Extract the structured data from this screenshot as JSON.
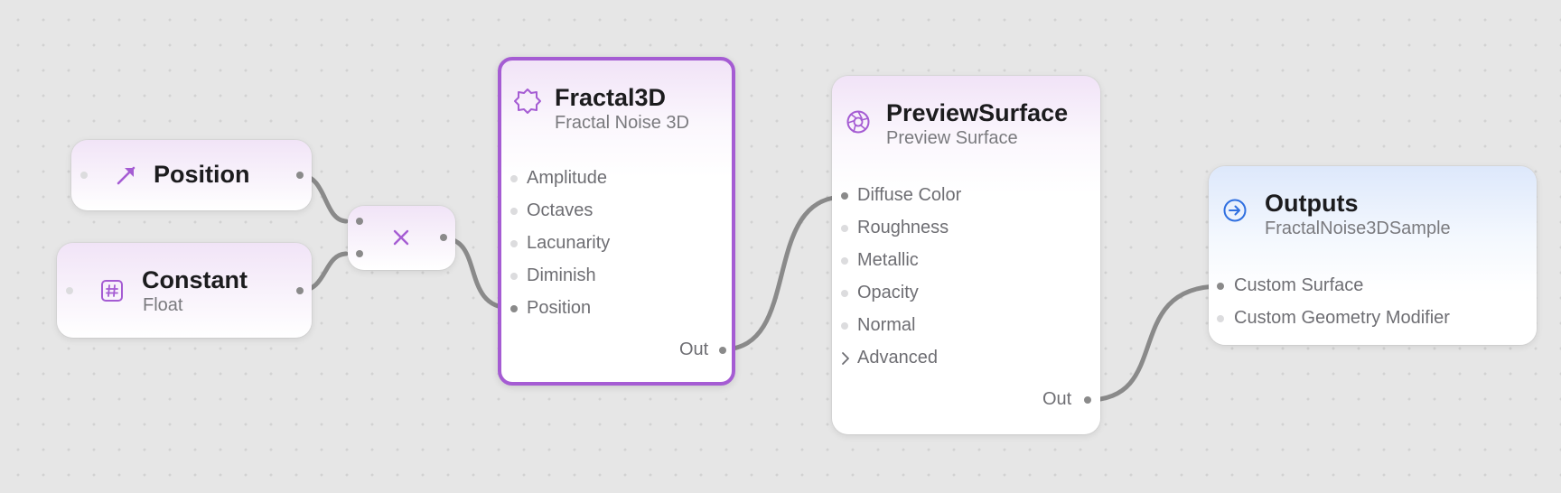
{
  "nodes": {
    "position": {
      "title": "Position",
      "icon": "arrow-up-right-icon"
    },
    "constant": {
      "title": "Constant",
      "subtitle": "Float",
      "icon": "number-sign-icon"
    },
    "multiply": {
      "icon": "multiply-icon"
    },
    "fractal3d": {
      "title": "Fractal3D",
      "subtitle": "Fractal Noise 3D",
      "icon": "fractal-icon",
      "inputs": [
        "Amplitude",
        "Octaves",
        "Lacunarity",
        "Diminish",
        "Position"
      ],
      "output": "Out"
    },
    "preview_surface": {
      "title": "PreviewSurface",
      "subtitle": "Preview Surface",
      "icon": "aperture-icon",
      "inputs": [
        "Diffuse Color",
        "Roughness",
        "Metallic",
        "Opacity",
        "Normal"
      ],
      "advanced": "Advanced",
      "output": "Out"
    },
    "outputs": {
      "title": "Outputs",
      "subtitle": "FractalNoise3DSample",
      "icon": "arrow-right-circle-icon",
      "inputs": [
        "Custom Surface",
        "Custom Geometry Modifier"
      ]
    }
  },
  "colors": {
    "accent": "#a55cd3",
    "output_accent": "#2f6fe0",
    "wire": "#8a8a8a",
    "canvas": "#e6e6e6"
  }
}
